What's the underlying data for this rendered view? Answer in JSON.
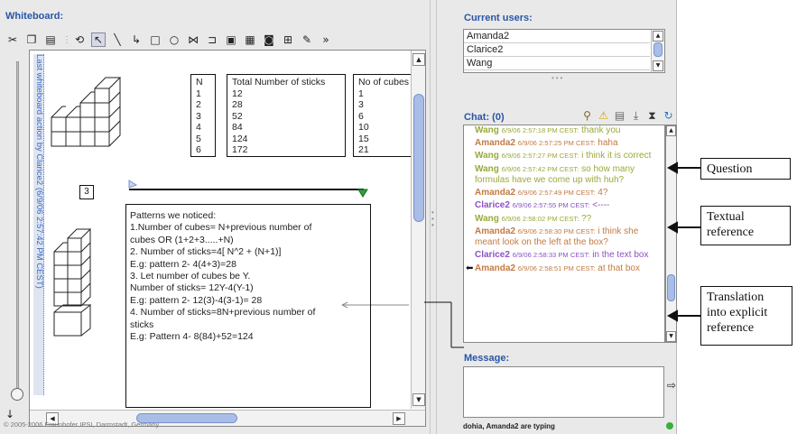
{
  "whiteboard": {
    "title": "Whiteboard:",
    "toolbar": {
      "tools": [
        {
          "icon": "scissors-icon",
          "glyph": "✂"
        },
        {
          "icon": "copy-icon",
          "glyph": "❐"
        },
        {
          "icon": "paste-icon",
          "glyph": "▤"
        },
        {
          "icon": "lasso-select-icon",
          "glyph": "⟲"
        },
        {
          "icon": "pointer-select-icon",
          "glyph": "↖",
          "active": true
        },
        {
          "icon": "line-tool-icon",
          "glyph": "╲"
        },
        {
          "icon": "connector-tool-icon",
          "glyph": "↳"
        },
        {
          "icon": "rectangle-tool-icon",
          "glyph": "□"
        },
        {
          "icon": "ellipse-tool-icon",
          "glyph": "○"
        },
        {
          "icon": "link-tool-icon",
          "glyph": "⋈"
        },
        {
          "icon": "reference-tool-icon",
          "glyph": "⊐"
        },
        {
          "icon": "textbox-tool-icon",
          "glyph": "▣"
        },
        {
          "icon": "image-tool-icon",
          "glyph": "▦"
        },
        {
          "icon": "camera-tool-icon",
          "glyph": "◙"
        },
        {
          "icon": "grid-tool-icon",
          "glyph": "⊞"
        },
        {
          "icon": "pen-tool-icon",
          "glyph": "✎"
        },
        {
          "icon": "more-tools-icon",
          "glyph": "»"
        }
      ]
    },
    "last_action": "Last whiteboard action by Clarice2 (6/9/06 2:57:42 PM CEST)",
    "tables": {
      "n_column": "N\n1\n2\n3\n4\n5\n6",
      "sticks_column": "Total Number of sticks\n12\n28\n52\n84\n124\n172",
      "cubes_column": "No of cubes\n1\n3\n6\n10\n15\n21"
    },
    "figure_number": "3",
    "patterns": [
      "Patterns we noticed:",
      "1.Number of cubes= N+previous number of",
      "cubes  OR (1+2+3.....+N)",
      "2. Number of sticks=4[ N^2 + (N+1)]",
      "E.g: pattern 2-  4(4+3)=28",
      "3. Let number of cubes be Y.",
      "Number of sticks= 12Y-4(Y-1)",
      "E.g: pattern 2-  12(3)-4(3-1)= 28",
      "4.  Number of sticks=8N+previous number of",
      "sticks",
      "E.g: Pattern 4- 8(84)+52=124"
    ],
    "copyright": "© 2005-2006 Fraunhofer IPSI, Darmstadt, Germany"
  },
  "users": {
    "title": "Current users:",
    "list": [
      "Amanda2",
      "Clarice2",
      "Wang"
    ]
  },
  "chat": {
    "title": "Chat: (0)",
    "icons": [
      "search-icon",
      "warning-icon",
      "print-icon",
      "download-icon",
      "hourglass-icon",
      "refresh-icon"
    ],
    "messages": [
      {
        "name": "Wang",
        "ts": "6/9/06 2:57:18 PM CEST:",
        "text": "thank you",
        "color": "#9aa93a"
      },
      {
        "name": "Amanda2",
        "ts": "6/9/06 2:57:25 PM CEST:",
        "text": "haha",
        "color": "#c37a45"
      },
      {
        "name": "Wang",
        "ts": "6/9/06 2:57:27 PM CEST:",
        "text": "i think it is correct",
        "color": "#9aa93a"
      },
      {
        "name": "Wang",
        "ts": "6/9/06 2:57:42 PM CEST:",
        "text": "so how many formulas have we come up with huh?",
        "color": "#9aa93a"
      },
      {
        "name": "Amanda2",
        "ts": "6/9/06 2:57:49 PM CEST:",
        "text": "4?",
        "color": "#c37a45"
      },
      {
        "name": "Clarice2",
        "ts": "6/9/06 2:57:55 PM CEST:",
        "text": "<----",
        "color": "#8b53c2"
      },
      {
        "name": "Wang",
        "ts": "6/9/06 2:58:02 PM CEST:",
        "text": "??",
        "color": "#9aa93a"
      },
      {
        "name": "Amanda2",
        "ts": "6/9/06 2:58:30 PM CEST:",
        "text": "i think she meant look on the left at the box?",
        "color": "#c37a45"
      },
      {
        "name": "Clarice2",
        "ts": "6/9/06 2:58:33 PM CEST:",
        "text": "in the text box",
        "color": "#8b53c2"
      },
      {
        "name": "Amanda2",
        "ts": "6/9/06 2:58:51 PM CEST:",
        "text": "at that box",
        "color": "#c37a45",
        "pointer": true
      }
    ]
  },
  "message": {
    "title": "Message:",
    "value": "",
    "typing_status": "dohia, Amanda2 are typing",
    "status_color": "#39b03b"
  },
  "annotations": [
    "Question",
    "Textual reference",
    "Translation into explicit reference"
  ]
}
